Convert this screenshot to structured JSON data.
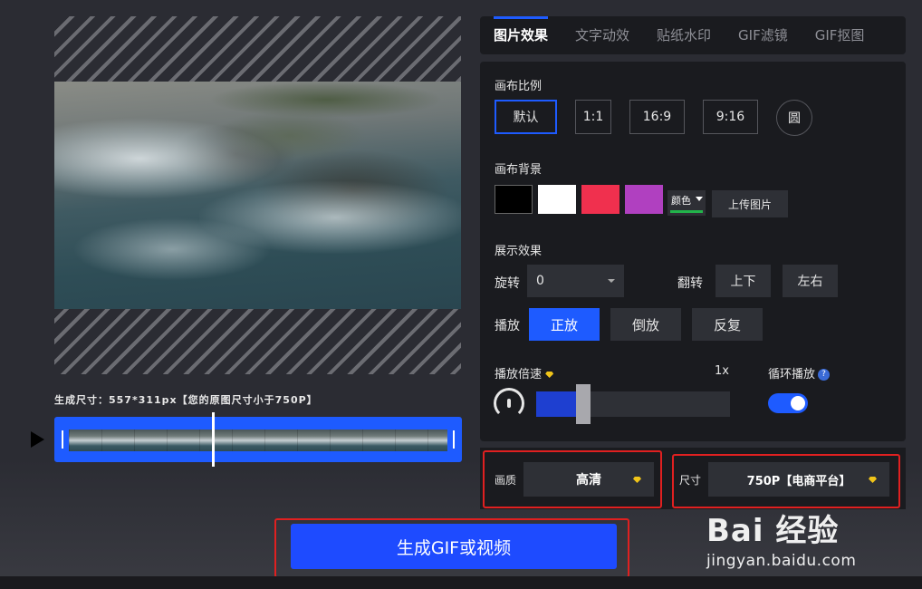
{
  "preview": {
    "size_text": "生成尺寸：557*311px【您的原图尺寸小于750P】"
  },
  "tabs": [
    {
      "label": "图片效果",
      "active": true
    },
    {
      "label": "文字动效"
    },
    {
      "label": "贴纸水印"
    },
    {
      "label": "GIF滤镜"
    },
    {
      "label": "GIF抠图"
    }
  ],
  "canvas_ratio": {
    "label": "画布比例",
    "options": [
      "默认",
      "1:1",
      "16:9",
      "9:16",
      "圆"
    ],
    "selected": "默认"
  },
  "canvas_bg": {
    "label": "画布背景",
    "swatches": [
      "#000000",
      "#ffffff",
      "#f0304e",
      "#b040c0"
    ],
    "color_picker_label": "颜色",
    "upload_label": "上传图片"
  },
  "display": {
    "label": "展示效果",
    "rotate_label": "旋转",
    "rotate_value": "0",
    "flip_label": "翻转",
    "flip_options": [
      "上下",
      "左右"
    ],
    "play_label": "播放",
    "play_options": [
      "正放",
      "倒放",
      "反复"
    ],
    "play_selected": "正放"
  },
  "speed": {
    "label": "播放倍速",
    "value_text": "1x",
    "level": 0.22
  },
  "loop": {
    "label": "循环播放",
    "help": "?",
    "enabled": true
  },
  "quality": {
    "label": "画质",
    "value": "高清"
  },
  "size": {
    "label": "尺寸",
    "value": "750P【电商平台】"
  },
  "generate": {
    "label": "生成GIF或视频"
  },
  "watermark": {
    "logo": "Bai  经验",
    "url": "jingyan.baidu.com"
  },
  "colors": {
    "accent": "#1e5bff",
    "highlight_box": "#e02020",
    "panel_bg": "#1a1b1f",
    "page_bg": "#2b2c33"
  }
}
